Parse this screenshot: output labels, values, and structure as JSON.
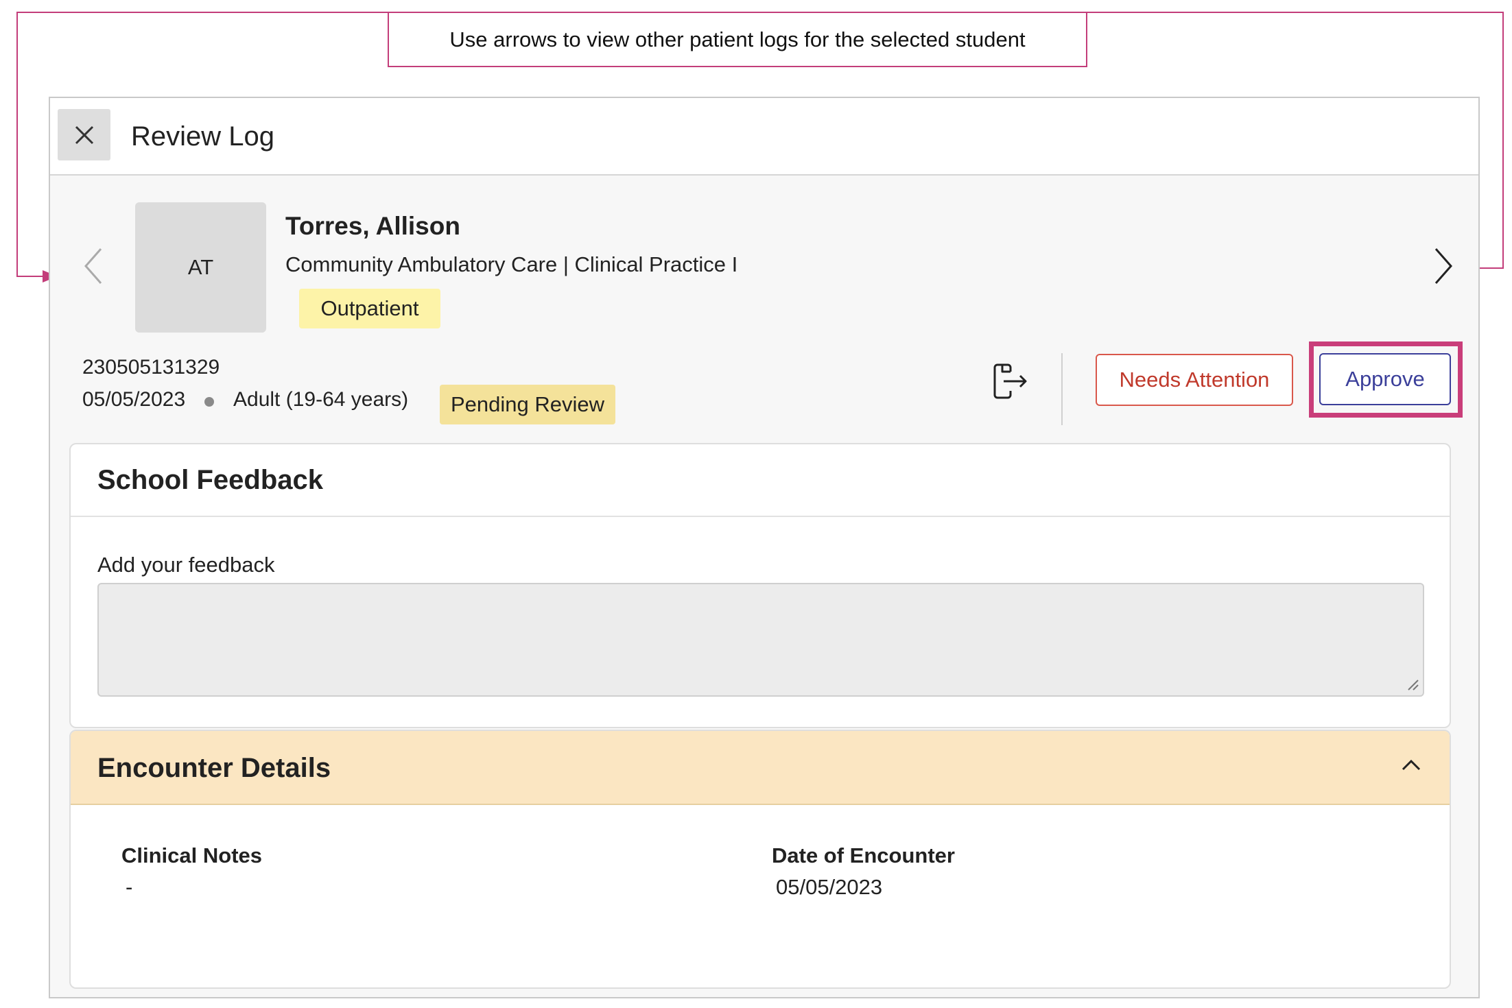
{
  "annotation": {
    "callout_text": "Use arrows to view other patient logs for the selected student",
    "color": "#c33d7a"
  },
  "panel": {
    "title": "Review Log",
    "close_icon": "close-icon"
  },
  "student": {
    "initials": "AT",
    "name": "Torres, Allison",
    "course": "Community Ambulatory Care | Clinical Practice I",
    "setting_badge": "Outpatient"
  },
  "log": {
    "id": "230505131329",
    "date": "05/05/2023",
    "age_group": "Adult (19-64 years)",
    "status": "Pending Review"
  },
  "actions": {
    "needs_attention_label": "Needs Attention",
    "approve_label": "Approve",
    "export_icon": "export-icon",
    "highlight_color": "#c93e7a"
  },
  "school_feedback": {
    "title": "School Feedback",
    "field_label": "Add your feedback",
    "value": ""
  },
  "encounter_details": {
    "title": "Encounter Details",
    "expanded": true,
    "fields": [
      {
        "label": "Clinical Notes",
        "value": "-"
      },
      {
        "label": "Date of Encounter",
        "value": "05/05/2023"
      }
    ]
  },
  "colors": {
    "outpatient_badge": "#fdf3a8",
    "pending_badge": "#f4e29a",
    "encounter_header": "#fbe6c2",
    "attention": "#c0392b",
    "approve": "#3b3f9a"
  }
}
